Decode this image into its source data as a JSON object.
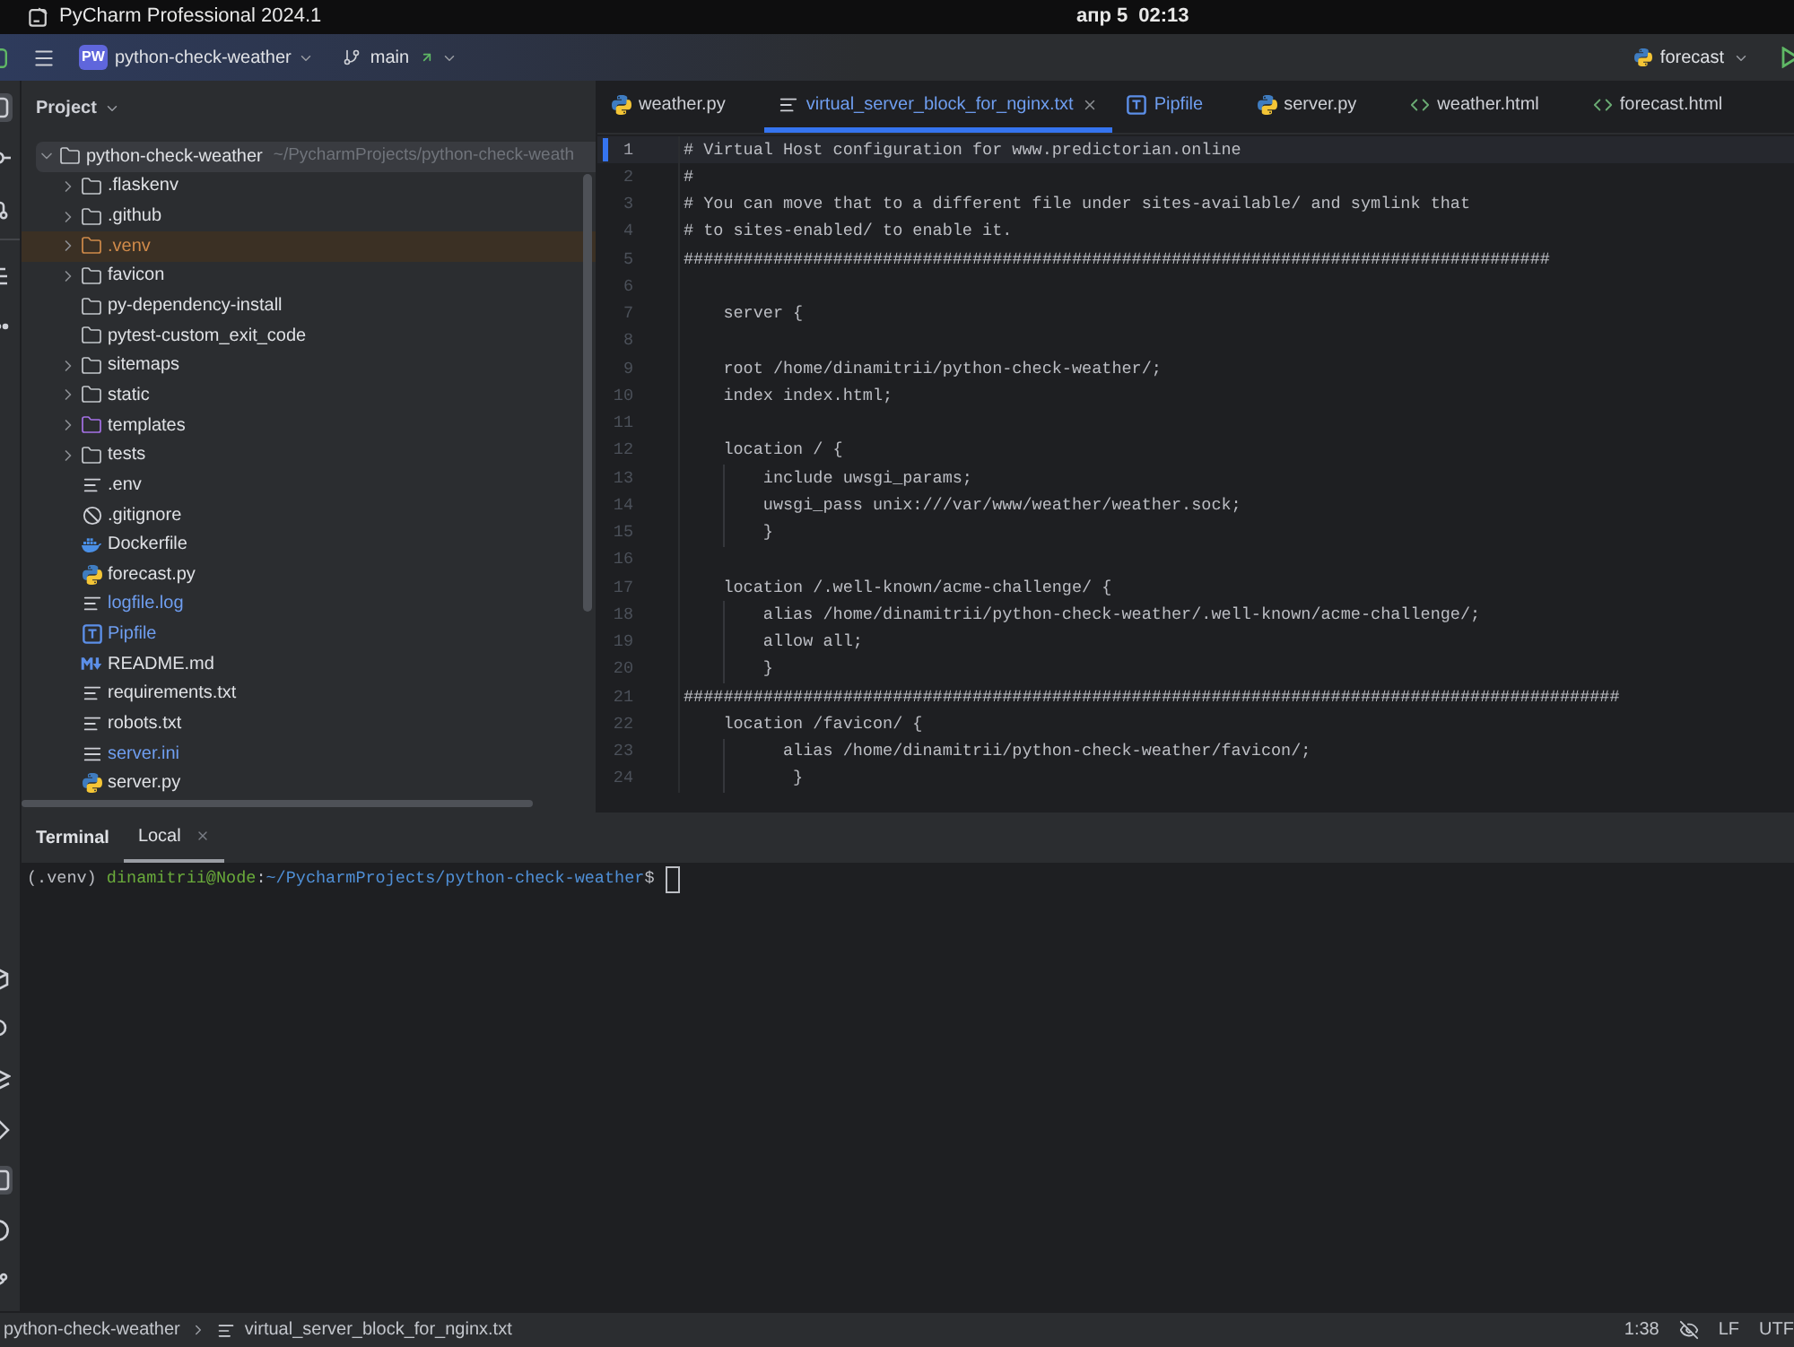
{
  "system_bar": {
    "app_title": "PyCharm Professional 2024.1",
    "date": "апр 5",
    "time": "02:13"
  },
  "toolbar": {
    "project_badge": "PW",
    "project_name": "python-check-weather",
    "branch": "main",
    "run_configuration": "forecast"
  },
  "tool_windows": {
    "top": [
      {
        "kind": "project",
        "selected": true
      },
      {
        "kind": "commit",
        "selected": false
      },
      {
        "kind": "pull-requests",
        "selected": false
      },
      {
        "kind": "structure",
        "selected": false
      },
      {
        "kind": "more",
        "selected": false
      }
    ],
    "bottom": [
      {
        "kind": "packages",
        "selected": false
      },
      {
        "kind": "console",
        "selected": false
      },
      {
        "kind": "services",
        "selected": false
      },
      {
        "kind": "endpoints",
        "selected": false
      },
      {
        "kind": "terminal",
        "selected": true
      },
      {
        "kind": "problems",
        "selected": false
      },
      {
        "kind": "git",
        "selected": false
      }
    ]
  },
  "project_panel": {
    "title": "Project",
    "tree": [
      {
        "name": "python-check-weather",
        "path": "~/PycharmProjects/python-check-weath",
        "kind": "folder",
        "modified": false,
        "expanded": true,
        "selected": true,
        "children": [
          {
            "name": ".flaskenv",
            "kind": "folder",
            "modified": false,
            "expanded": false,
            "selected": false
          },
          {
            "name": ".github",
            "kind": "folder",
            "modified": false,
            "expanded": false,
            "selected": false
          },
          {
            "name": ".venv",
            "kind": "excluded-folder",
            "modified": false,
            "expanded": false,
            "selected": false
          },
          {
            "name": "favicon",
            "kind": "folder",
            "modified": false,
            "expanded": false,
            "selected": false
          },
          {
            "name": "py-dependency-install",
            "kind": "folder",
            "modified": false,
            "selected": false
          },
          {
            "name": "pytest-custom_exit_code",
            "kind": "folder",
            "modified": false,
            "selected": false
          },
          {
            "name": "sitemaps",
            "kind": "folder",
            "modified": false,
            "expanded": false,
            "selected": false
          },
          {
            "name": "static",
            "kind": "folder",
            "modified": false,
            "expanded": false,
            "selected": false
          },
          {
            "name": "templates",
            "kind": "template-folder",
            "modified": false,
            "expanded": false,
            "selected": false
          },
          {
            "name": "tests",
            "kind": "folder",
            "modified": false,
            "expanded": false,
            "selected": false
          },
          {
            "name": ".env",
            "kind": "text",
            "modified": false,
            "selected": false
          },
          {
            "name": ".gitignore",
            "kind": "ignore",
            "modified": false,
            "selected": false
          },
          {
            "name": "Dockerfile",
            "kind": "docker",
            "modified": false,
            "selected": false
          },
          {
            "name": "forecast.py",
            "kind": "python",
            "modified": false,
            "selected": false
          },
          {
            "name": "logfile.log",
            "kind": "text",
            "modified": true,
            "selected": false
          },
          {
            "name": "Pipfile",
            "kind": "toml",
            "modified": true,
            "selected": false
          },
          {
            "name": "README.md",
            "kind": "markdown",
            "modified": false,
            "selected": false
          },
          {
            "name": "requirements.txt",
            "kind": "text",
            "modified": false,
            "selected": false
          },
          {
            "name": "robots.txt",
            "kind": "text",
            "modified": false,
            "selected": false
          },
          {
            "name": "server.ini",
            "kind": "config",
            "modified": true,
            "selected": false
          },
          {
            "name": "server.py",
            "kind": "python",
            "modified": false,
            "selected": false
          }
        ]
      }
    ]
  },
  "editor": {
    "tabs": [
      {
        "name": "weather.py",
        "kind": "python",
        "modified": false,
        "selected": false
      },
      {
        "name": "virtual_server_block_for_nginx.txt",
        "kind": "text",
        "modified": true,
        "selected": true
      },
      {
        "name": "Pipfile",
        "kind": "toml",
        "modified": true,
        "selected": false
      },
      {
        "name": "server.py",
        "kind": "python",
        "modified": false,
        "selected": false
      },
      {
        "name": "weather.html",
        "kind": "html",
        "modified": false,
        "selected": false
      },
      {
        "name": "forecast.html",
        "kind": "html",
        "modified": false,
        "selected": false
      }
    ],
    "lines": [
      {
        "number": "1",
        "text": "# Virtual Host configuration for www.predictorian.online",
        "current": true,
        "changed": true
      },
      {
        "number": "2",
        "text": "#",
        "current": false,
        "changed": false
      },
      {
        "number": "3",
        "text": "# You can move that to a different file under sites-available/ and symlink that",
        "current": false,
        "changed": false
      },
      {
        "number": "4",
        "text": "# to sites-enabled/ to enable it.",
        "current": false,
        "changed": false
      },
      {
        "number": "5",
        "text": "#######################################################################################",
        "current": false,
        "changed": false
      },
      {
        "number": "6",
        "current": false,
        "changed": false
      },
      {
        "number": "7",
        "text": "    server {",
        "current": false,
        "changed": false
      },
      {
        "number": "8",
        "current": false,
        "changed": false
      },
      {
        "number": "9",
        "text": "    root /home/dinamitrii/python-check-weather/;",
        "current": false,
        "changed": false
      },
      {
        "number": "10",
        "text": "    index index.html;",
        "current": false,
        "changed": false
      },
      {
        "number": "11",
        "current": false,
        "changed": false
      },
      {
        "number": "12",
        "text": "    location / {",
        "current": false,
        "changed": false
      },
      {
        "number": "13",
        "text": "        include uwsgi_params;",
        "current": false,
        "changed": false
      },
      {
        "number": "14",
        "text": "        uwsgi_pass unix:///var/www/weather/weather.sock;",
        "current": false,
        "changed": false
      },
      {
        "number": "15",
        "text": "        }",
        "current": false,
        "changed": false
      },
      {
        "number": "16",
        "current": false,
        "changed": false
      },
      {
        "number": "17",
        "text": "    location /.well-known/acme-challenge/ {",
        "current": false,
        "changed": false
      },
      {
        "number": "18",
        "text": "        alias /home/dinamitrii/python-check-weather/.well-known/acme-challenge/;",
        "current": false,
        "changed": false
      },
      {
        "number": "19",
        "text": "        allow all;",
        "current": false,
        "changed": false
      },
      {
        "number": "20",
        "text": "        }",
        "current": false,
        "changed": false
      },
      {
        "number": "21",
        "text": "##############################################################################################",
        "current": false,
        "changed": false
      },
      {
        "number": "22",
        "text": "    location /favicon/ {",
        "current": false,
        "changed": false
      },
      {
        "number": "23",
        "text": "          alias /home/dinamitrii/python-check-weather/favicon/;",
        "current": false,
        "changed": false
      },
      {
        "number": "24",
        "text": "           }",
        "current": false,
        "changed": false
      }
    ]
  },
  "terminal": {
    "title": "Terminal",
    "tabs": [
      {
        "label": "Local",
        "selected": true
      }
    ],
    "prompt": {
      "env": "(.venv)",
      "user": "dinamitrii@Node",
      "separator": ":",
      "path": "~/PycharmProjects/python-check-weather",
      "symbol": "$"
    }
  },
  "status_bar": {
    "breadcrumbs": [
      {
        "label": "python-check-weather",
        "kind": "project"
      },
      {
        "label": "virtual_server_block_for_nginx.txt",
        "kind": "text"
      }
    ],
    "position": "1:38",
    "line_separator": "LF",
    "encoding": "UTF"
  }
}
